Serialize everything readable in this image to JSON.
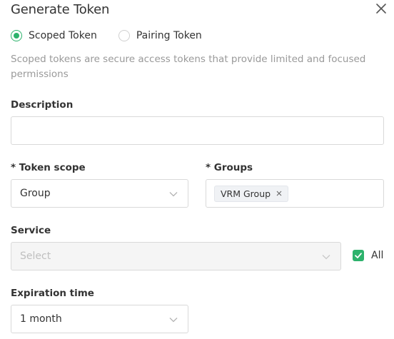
{
  "dialog": {
    "title": "Generate Token"
  },
  "token_type": {
    "options": [
      {
        "label": "Scoped Token",
        "checked": true
      },
      {
        "label": "Pairing Token",
        "checked": false
      }
    ],
    "description": "Scoped tokens are secure access tokens that provide limited and focused permissions"
  },
  "form": {
    "description": {
      "label": "Description",
      "value": ""
    },
    "token_scope": {
      "label": "* Token scope",
      "value": "Group"
    },
    "groups": {
      "label": "* Groups",
      "tags": [
        "VRM Group"
      ]
    },
    "service": {
      "label": "Service",
      "placeholder": "Select",
      "all_label": "All",
      "all_checked": true
    },
    "expiration": {
      "label": "Expiration time",
      "value": "1 month"
    }
  },
  "colors": {
    "accent": "#2db26c",
    "muted_text": "#999999",
    "border": "#d9d9d9"
  },
  "icons": {
    "close": "close-icon",
    "dropdown": "chevron-down-icon",
    "tag_remove": "x-icon",
    "check": "checkmark-icon"
  }
}
